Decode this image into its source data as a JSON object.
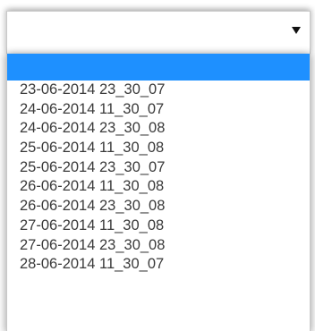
{
  "select": {
    "value": "",
    "arrow_icon": "triangle-down-icon"
  },
  "dropdown": {
    "highlight_color": "#1e90ff",
    "options": [
      "",
      "23-06-2014 23_30_07",
      "24-06-2014 11_30_07",
      "24-06-2014 23_30_08",
      "25-06-2014 11_30_08",
      "25-06-2014 23_30_07",
      "26-06-2014 11_30_08",
      "26-06-2014 23_30_08",
      "27-06-2014 11_30_08",
      "27-06-2014 23_30_08",
      "28-06-2014 11_30_07"
    ]
  }
}
